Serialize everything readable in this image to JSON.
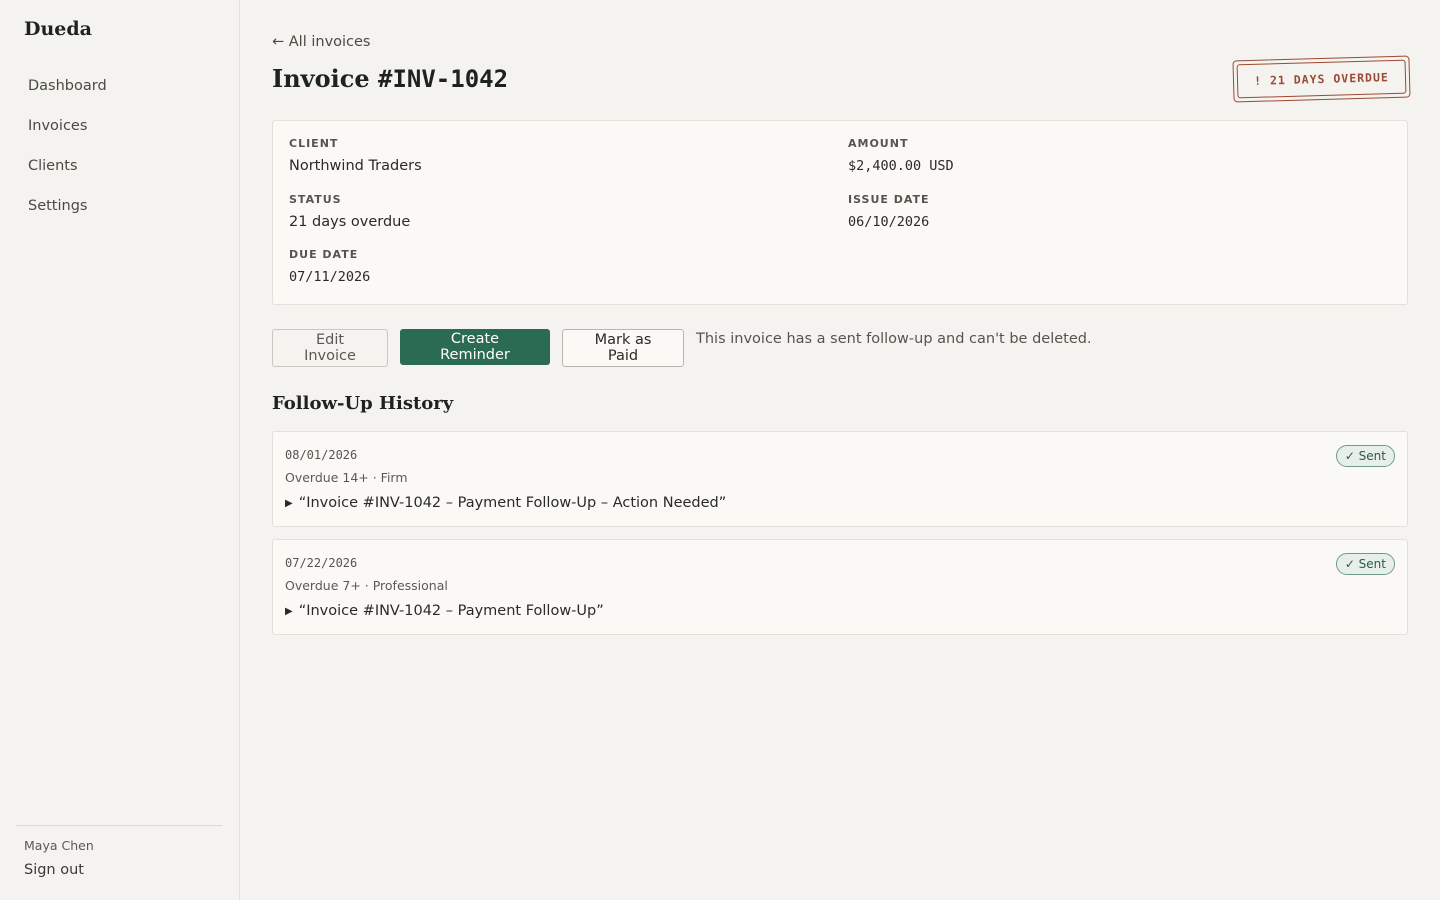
{
  "brand": "Dueda",
  "nav": {
    "items": [
      {
        "label": "Dashboard"
      },
      {
        "label": "Invoices"
      },
      {
        "label": "Clients"
      },
      {
        "label": "Settings"
      }
    ]
  },
  "user": {
    "name": "Maya Chen",
    "sign_out": "Sign out"
  },
  "header": {
    "back_link": "← All invoices",
    "title_prefix": "Invoice",
    "title_number": "#INV-1042",
    "stamp": "! 21 DAYS OVERDUE"
  },
  "invoice": {
    "client_label": "CLIENT",
    "client": "Northwind Traders",
    "amount_label": "AMOUNT",
    "amount": "$2,400.00 USD",
    "status_label": "STATUS",
    "status": "21 days overdue",
    "issue_date_label": "ISSUE DATE",
    "issue_date": "06/10/2026",
    "due_date_label": "DUE DATE",
    "due_date": "07/11/2026"
  },
  "actions": {
    "edit": "Edit Invoice",
    "create_reminder": "Create Reminder",
    "mark_paid": "Mark as Paid",
    "note": "This invoice has a sent follow-up and can't be deleted."
  },
  "history": {
    "title": "Follow-Up History",
    "items": [
      {
        "date": "08/01/2026",
        "meta": "Overdue 14+ · Firm",
        "subject": "“Invoice #INV-1042 – Payment Follow-Up – Action Needed”",
        "status": "✓ Sent"
      },
      {
        "date": "07/22/2026",
        "meta": "Overdue 7+ · Professional",
        "subject": "“Invoice #INV-1042 – Payment Follow-Up”",
        "status": "✓ Sent"
      }
    ]
  },
  "colors": {
    "accent": "#2b6b52",
    "overdue_stamp": "#9a4a35",
    "background": "#f4f3ef",
    "card": "#faf9f6"
  },
  "icons": {
    "expand": "triangle-right-icon",
    "check": "check-icon",
    "back": "arrow-left-icon"
  }
}
